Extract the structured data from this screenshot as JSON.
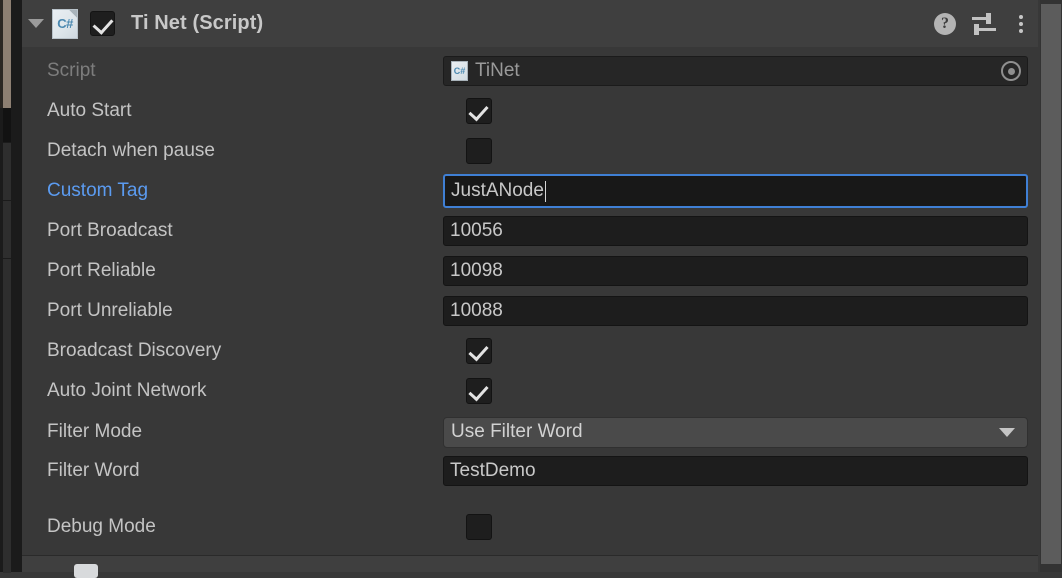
{
  "component": {
    "title": "Ti Net (Script)",
    "enabled_checkbox": true,
    "expanded": true,
    "script_icon_label": "C#",
    "header_icons": {
      "help": "?",
      "help_name": "help-icon",
      "preset_name": "preset-icon",
      "menu_name": "more-menu-icon"
    }
  },
  "fields": {
    "script": {
      "label": "Script",
      "value": "TiNet",
      "icon_label": "C#",
      "disabled": true
    },
    "auto_start": {
      "label": "Auto Start",
      "checked": true
    },
    "detach_when_pause": {
      "label": "Detach when pause",
      "checked": false
    },
    "custom_tag": {
      "label": "Custom Tag",
      "value": "JustANode",
      "focused": true,
      "label_color": "#5b9bf0"
    },
    "port_broadcast": {
      "label": "Port Broadcast",
      "value": "10056"
    },
    "port_reliable": {
      "label": "Port Reliable",
      "value": "10098"
    },
    "port_unreliable": {
      "label": "Port Unreliable",
      "value": "10088"
    },
    "broadcast_discovery": {
      "label": "Broadcast Discovery",
      "checked": true
    },
    "auto_joint_network": {
      "label": "Auto Joint Network",
      "checked": true
    },
    "filter_mode": {
      "label": "Filter Mode",
      "value": "Use Filter Word"
    },
    "filter_word": {
      "label": "Filter Word",
      "value": "TestDemo"
    },
    "debug_mode": {
      "label": "Debug Mode",
      "checked": false
    }
  },
  "theme": {
    "panel_bg": "#383838",
    "header_bg": "#3f3f3f",
    "field_bg": "#1d1d1d",
    "accent_blue": "#3f7fd4",
    "label_text": "#c4c4c4",
    "dim_text": "#7d7d7d",
    "dropdown_bg": "#4a4a4a",
    "scrollbar": "#5c5c5c"
  }
}
